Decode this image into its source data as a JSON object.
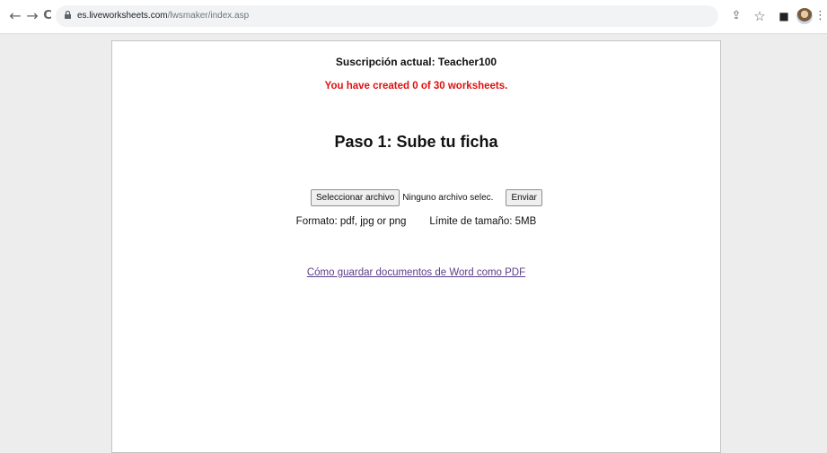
{
  "browser": {
    "url_domain": "es.liveworksheets.com",
    "url_path": "/lwsmaker/index.asp",
    "back_glyph": "←",
    "forward_glyph": "→",
    "reload_glyph": "C",
    "share_glyph": "⇪",
    "star_glyph": "☆",
    "tabsearch_glyph": "■",
    "menu_glyph": "⋮",
    "icons": [
      "back-arrow-icon",
      "forward-arrow-icon",
      "reload-icon",
      "lock-icon",
      "share-icon",
      "bookmark-star-icon",
      "side-panel-icon",
      "profile-avatar",
      "kebab-menu-icon"
    ]
  },
  "page": {
    "subscription": "Suscripción actual: Teacher100",
    "worksheets_created": "You have created 0 of 30 worksheets.",
    "step_title": "Paso 1: Sube tu ficha",
    "choose_file_button": "Seleccionar archivo",
    "file_status": "Ninguno archivo selec.",
    "send_button": "Enviar",
    "format": "Formato: pdf, jpg or png",
    "size_limit": "Límite de tamaño: 5MB",
    "pdf_link": "Cómo guardar documentos de Word como PDF"
  },
  "colors": {
    "warning_red": "#e01010",
    "link_visited": "#5b3d8a",
    "page_background": "#ededed"
  }
}
